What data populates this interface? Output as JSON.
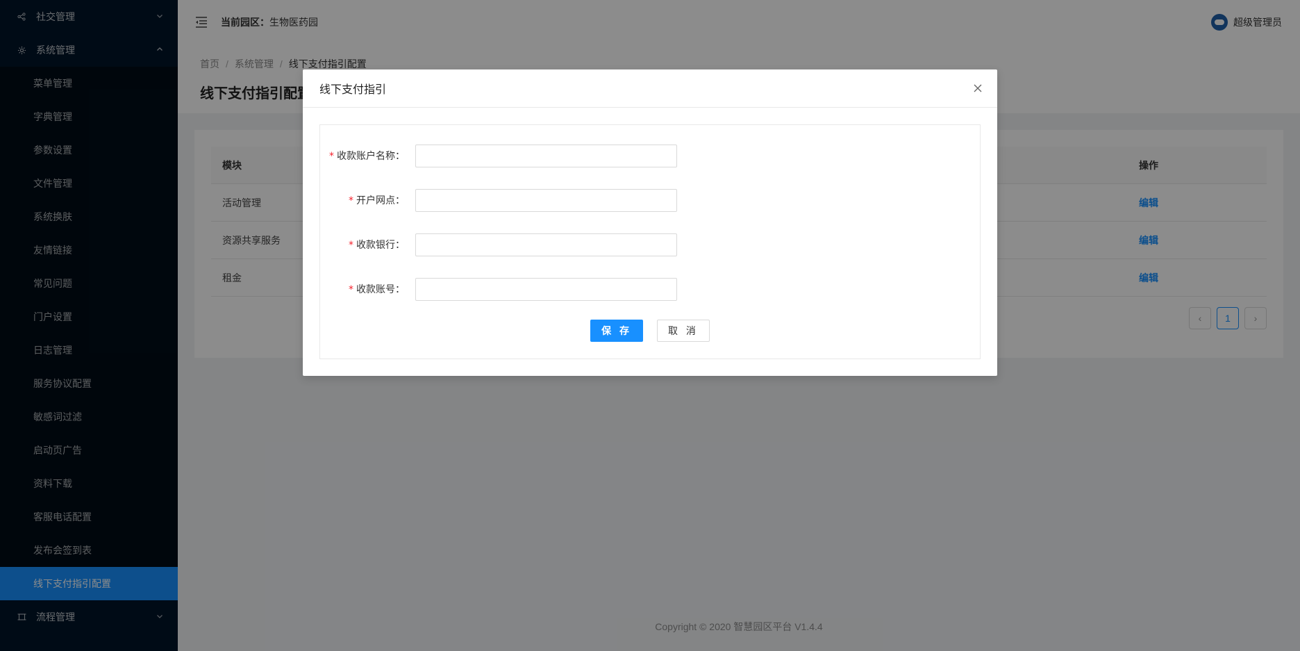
{
  "sidebar": {
    "groups": [
      {
        "label": "社交管理",
        "icon": "share-icon",
        "expanded": false
      },
      {
        "label": "系统管理",
        "icon": "gear-icon",
        "expanded": true
      },
      {
        "label": "流程管理",
        "icon": "flow-icon",
        "expanded": false
      }
    ],
    "items": [
      {
        "label": "菜单管理"
      },
      {
        "label": "字典管理"
      },
      {
        "label": "参数设置"
      },
      {
        "label": "文件管理"
      },
      {
        "label": "系统换肤"
      },
      {
        "label": "友情链接"
      },
      {
        "label": "常见问题"
      },
      {
        "label": "门户设置"
      },
      {
        "label": "日志管理"
      },
      {
        "label": "服务协议配置"
      },
      {
        "label": "敏感词过滤"
      },
      {
        "label": "启动页广告"
      },
      {
        "label": "资料下载"
      },
      {
        "label": "客服电话配置"
      },
      {
        "label": "发布会签到表"
      },
      {
        "label": "线下支付指引配置",
        "active": true
      }
    ]
  },
  "header": {
    "park_label": "当前园区：",
    "park_name": "生物医药园",
    "user_name": "超级管理员"
  },
  "breadcrumb": [
    "首页",
    "系统管理",
    "线下支付指引配置"
  ],
  "page_title": "线下支付指引配置",
  "table": {
    "columns": [
      "模块",
      "操作"
    ],
    "rows": [
      {
        "module": "活动管理",
        "action": "编辑"
      },
      {
        "module": "资源共享服务",
        "action": "编辑"
      },
      {
        "module": "租金",
        "action": "编辑"
      }
    ]
  },
  "pagination": {
    "prev": "‹",
    "current": "1",
    "next": "›"
  },
  "footer": {
    "text": "Copyright © 2020 智慧园区平台 V1.4.4"
  },
  "modal": {
    "title": "线下支付指引",
    "fields": [
      {
        "label": "收款账户名称：",
        "value": "",
        "required": "*"
      },
      {
        "label": "开户网点：",
        "value": "",
        "required": "*"
      },
      {
        "label": "收款银行：",
        "value": "",
        "required": "*"
      },
      {
        "label": "收款账号：",
        "value": "",
        "required": "*"
      }
    ],
    "save_label": "保 存",
    "cancel_label": "取 消"
  },
  "colors": {
    "primary": "#1890ff",
    "sidebar": "#001529",
    "required": "#f5222d"
  }
}
